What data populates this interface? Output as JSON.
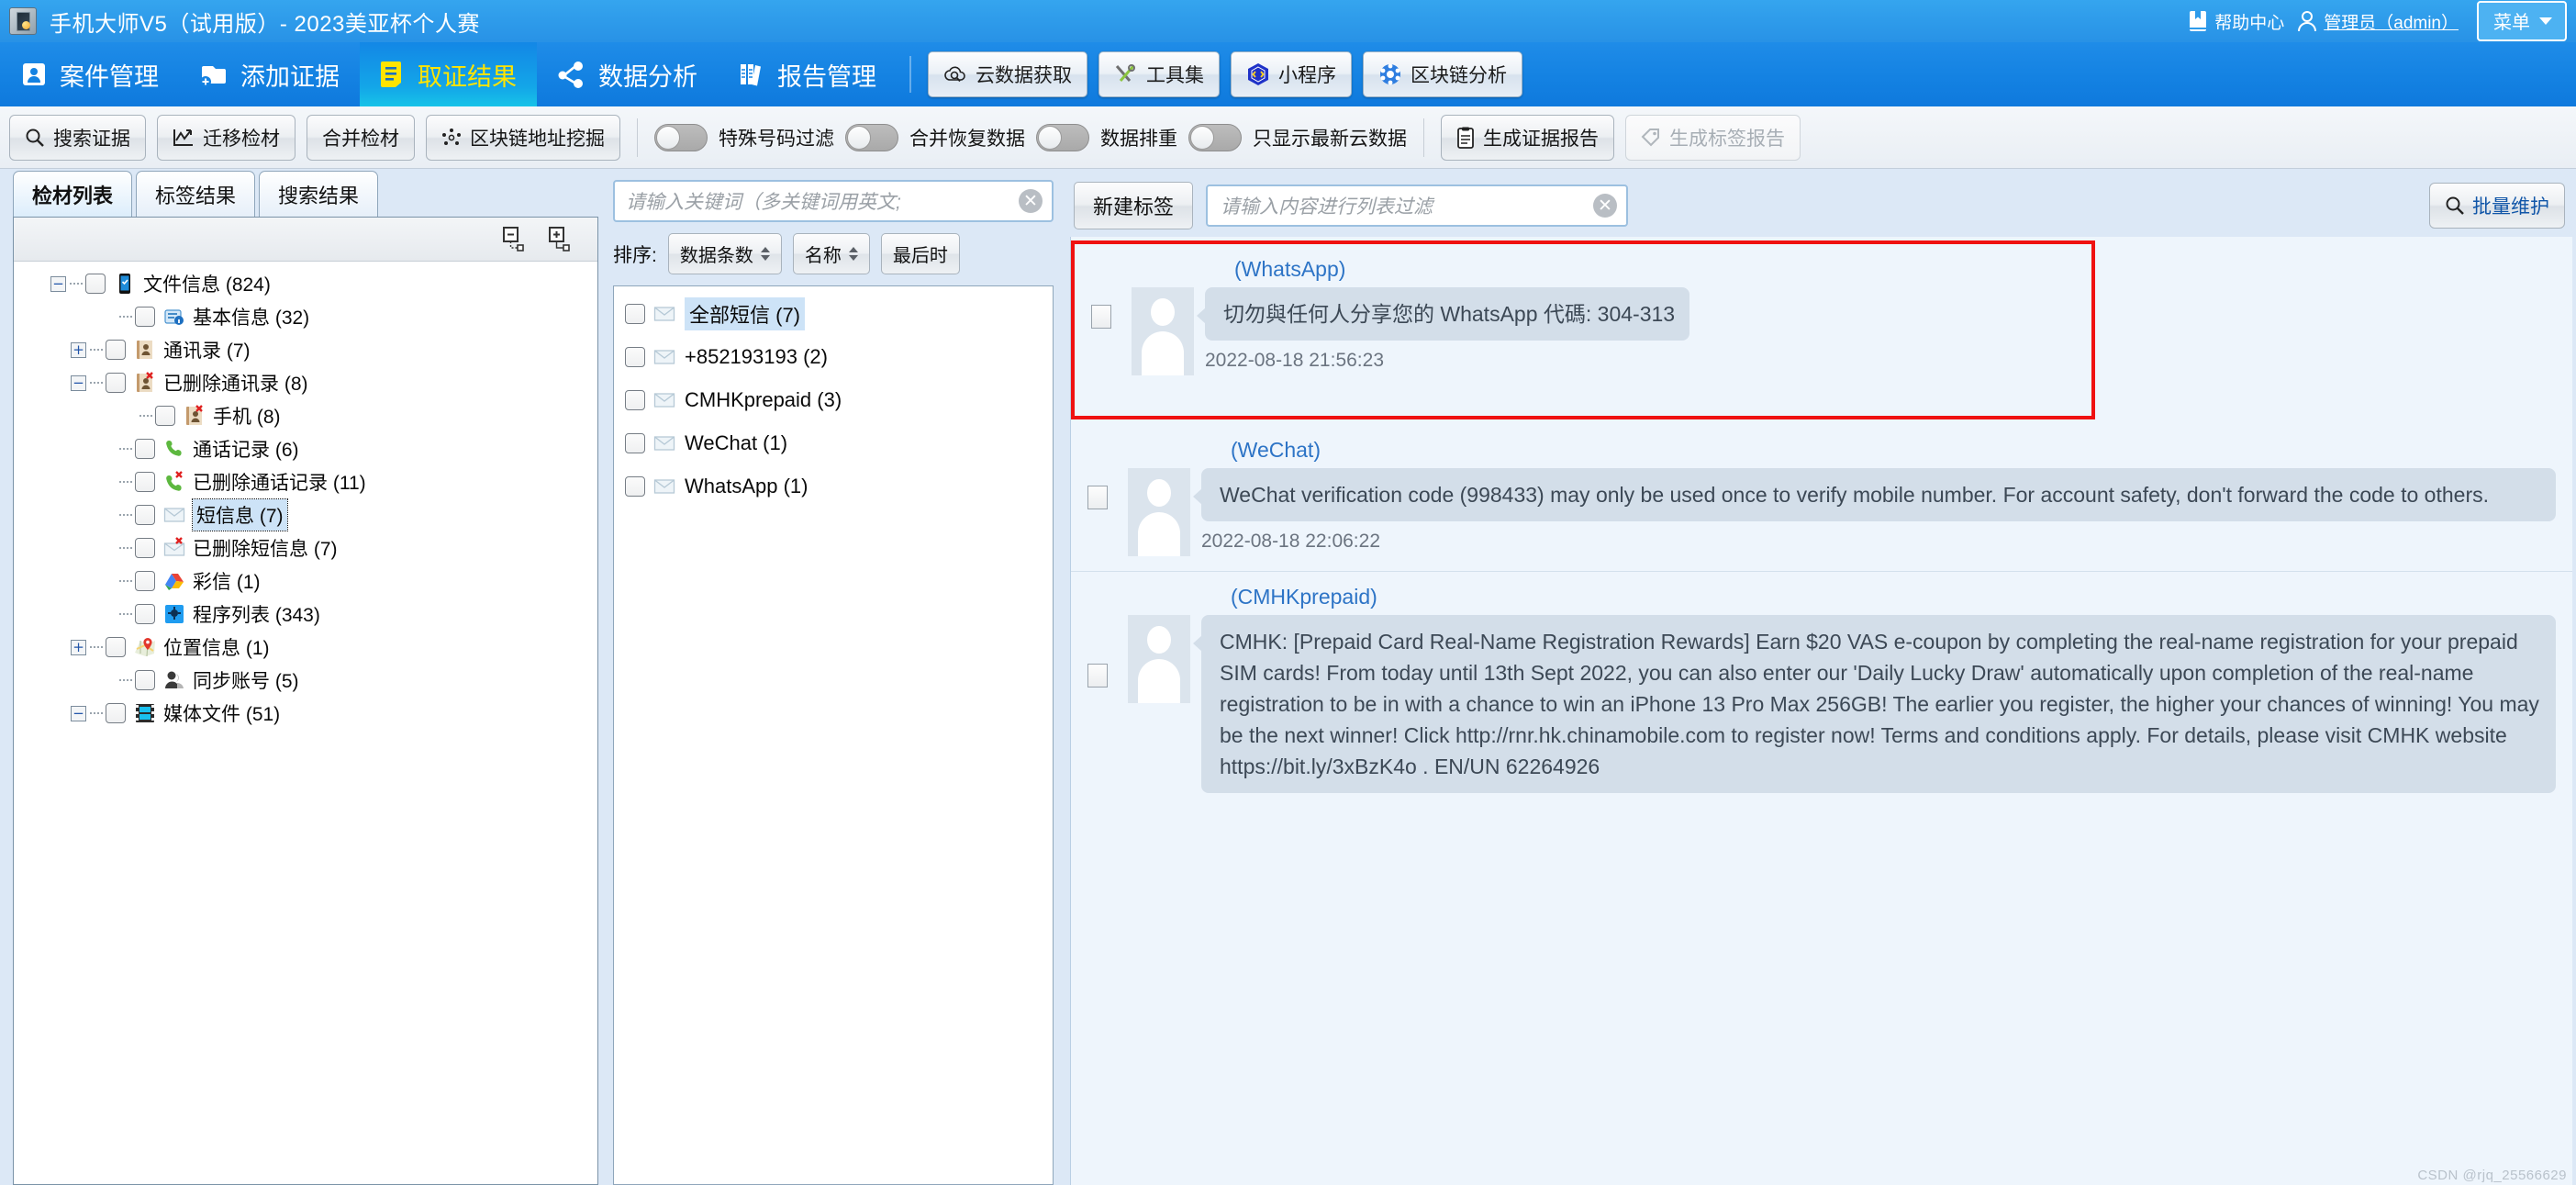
{
  "titlebar": {
    "app_title": "手机大师V5（试用版）- 2023美亚杯个人赛",
    "help_center": "帮助中心",
    "user": "管理员（admin）",
    "menu": "菜单"
  },
  "nav": {
    "tabs": [
      {
        "label": "案件管理",
        "icon": "case-card-icon",
        "active": false
      },
      {
        "label": "添加证据",
        "icon": "add-evidence-icon",
        "active": false
      },
      {
        "label": "取证结果",
        "icon": "forensic-result-icon",
        "active": true
      },
      {
        "label": "数据分析",
        "icon": "data-analysis-icon",
        "active": false
      },
      {
        "label": "报告管理",
        "icon": "report-manage-icon",
        "active": false
      }
    ],
    "right_buttons": [
      {
        "label": "云数据获取",
        "icon": "cloud-fetch-icon"
      },
      {
        "label": "工具集",
        "icon": "tools-icon"
      },
      {
        "label": "小程序",
        "icon": "mini-program-icon"
      },
      {
        "label": "区块链分析",
        "icon": "blockchain-icon"
      }
    ]
  },
  "toolbar": {
    "buttons": [
      {
        "label": "搜索证据",
        "icon": "search-icon",
        "disabled": false
      },
      {
        "label": "迁移检材",
        "icon": "migrate-icon",
        "disabled": false
      },
      {
        "label": "合并检材",
        "icon": "",
        "disabled": false
      },
      {
        "label": "区块链地址挖掘",
        "icon": "blockchain-addr-icon",
        "disabled": false
      }
    ],
    "toggles": [
      {
        "label": "特殊号码过滤",
        "on": false
      },
      {
        "label": "合并恢复数据",
        "on": false
      },
      {
        "label": "数据排重",
        "on": false
      },
      {
        "label": "只显示最新云数据",
        "on": false
      }
    ],
    "right_buttons": [
      {
        "label": "生成证据报告",
        "icon": "report-icon",
        "disabled": false
      },
      {
        "label": "生成标签报告",
        "icon": "tag-icon",
        "disabled": true
      }
    ]
  },
  "left_pane": {
    "tabs": [
      {
        "label": "检材列表",
        "active": true
      },
      {
        "label": "标签结果",
        "active": false
      },
      {
        "label": "搜索结果",
        "active": false
      }
    ],
    "tree_toolbar": [
      {
        "name": "collapse-all-icon"
      },
      {
        "name": "expand-all-icon"
      }
    ],
    "tree": [
      {
        "label": "文件信息 (824)",
        "indent": 0,
        "expander": "-",
        "icon": "phone-icon"
      },
      {
        "label": "基本信息 (32)",
        "indent": 1,
        "expander": "",
        "icon": "info-icon"
      },
      {
        "label": "通讯录 (7)",
        "indent": 1,
        "expander": "+",
        "icon": "contacts-icon"
      },
      {
        "label": "已删除通讯录 (8)",
        "indent": 1,
        "expander": "-",
        "icon": "contacts-deleted-icon"
      },
      {
        "label": "手机 (8)",
        "indent": 2,
        "expander": "",
        "icon": "contacts-deleted-icon"
      },
      {
        "label": "通话记录 (6)",
        "indent": 1,
        "expander": "",
        "icon": "call-icon"
      },
      {
        "label": "已删除通话记录 (11)",
        "indent": 1,
        "expander": "",
        "icon": "call-deleted-icon"
      },
      {
        "label": "短信息 (7)",
        "indent": 1,
        "expander": "",
        "icon": "sms-icon",
        "selected": true
      },
      {
        "label": "已删除短信息 (7)",
        "indent": 1,
        "expander": "",
        "icon": "sms-deleted-icon"
      },
      {
        "label": "彩信 (1)",
        "indent": 1,
        "expander": "",
        "icon": "mms-icon"
      },
      {
        "label": "程序列表 (343)",
        "indent": 1,
        "expander": "",
        "icon": "apps-icon"
      },
      {
        "label": "位置信息 (1)",
        "indent": 1,
        "expander": "+",
        "icon": "location-icon"
      },
      {
        "label": "同步账号 (5)",
        "indent": 1,
        "expander": "",
        "icon": "account-icon"
      },
      {
        "label": "媒体文件 (51)",
        "indent": 1,
        "expander": "-",
        "icon": "media-icon"
      }
    ]
  },
  "mid_pane": {
    "search_placeholder": "请输入关键词（多关键词用英文;",
    "sort_label": "排序:",
    "sort_buttons": [
      {
        "label": "数据条数"
      },
      {
        "label": "名称"
      },
      {
        "label": "最后时"
      }
    ],
    "items": [
      {
        "label": "全部短信 (7)",
        "selected": true
      },
      {
        "label": "+852193193 (2)",
        "selected": false
      },
      {
        "label": "CMHKprepaid (3)",
        "selected": false
      },
      {
        "label": "WeChat (1)",
        "selected": false
      },
      {
        "label": "WhatsApp (1)",
        "selected": false
      }
    ]
  },
  "right_pane": {
    "new_tag_button": "新建标签",
    "filter_placeholder": "请输入内容进行列表过滤",
    "batch_button": "批量维护",
    "messages": [
      {
        "sender": "(WhatsApp)",
        "text": "切勿與任何人分享您的 WhatsApp 代碼: 304-313",
        "time": "2022-08-18 21:56:23",
        "highlighted": true
      },
      {
        "sender": "(WeChat)",
        "text": "WeChat verification code (998433) may only be used once to verify mobile number. For account safety, don't forward the code to others.",
        "time": "2022-08-18 22:06:22",
        "highlighted": false
      },
      {
        "sender": "(CMHKprepaid)",
        "text": "CMHK: [Prepaid Card Real-Name Registration Rewards] Earn $20 VAS e-coupon by completing the real-name registration for your prepaid SIM cards! From today until 13th Sept 2022, you can also enter our 'Daily Lucky Draw'  automatically upon completion of the real-name registration to be in with a chance to win an iPhone 13 Pro Max 256GB! The earlier you register, the higher your chances of winning! You may be the next winner! Click http://rnr.hk.chinamobile.com to register now! Terms and conditions apply. For details, please visit CMHK website https://bit.ly/3xBzK4o . EN/UN 62264926",
        "time": "",
        "highlighted": false
      }
    ]
  },
  "watermark": "CSDN @rjq_25566629",
  "colors": {
    "title_blue": "#2e9bea",
    "nav_blue": "#1482e2",
    "active_tab_yellow": "#ffe400",
    "pane_bg": "#dce8f6",
    "highlight_red": "#ef1111",
    "selection_blue": "#cde3f7",
    "bubble_gray": "#d3dee9",
    "sender_blue": "#2d74c6"
  }
}
